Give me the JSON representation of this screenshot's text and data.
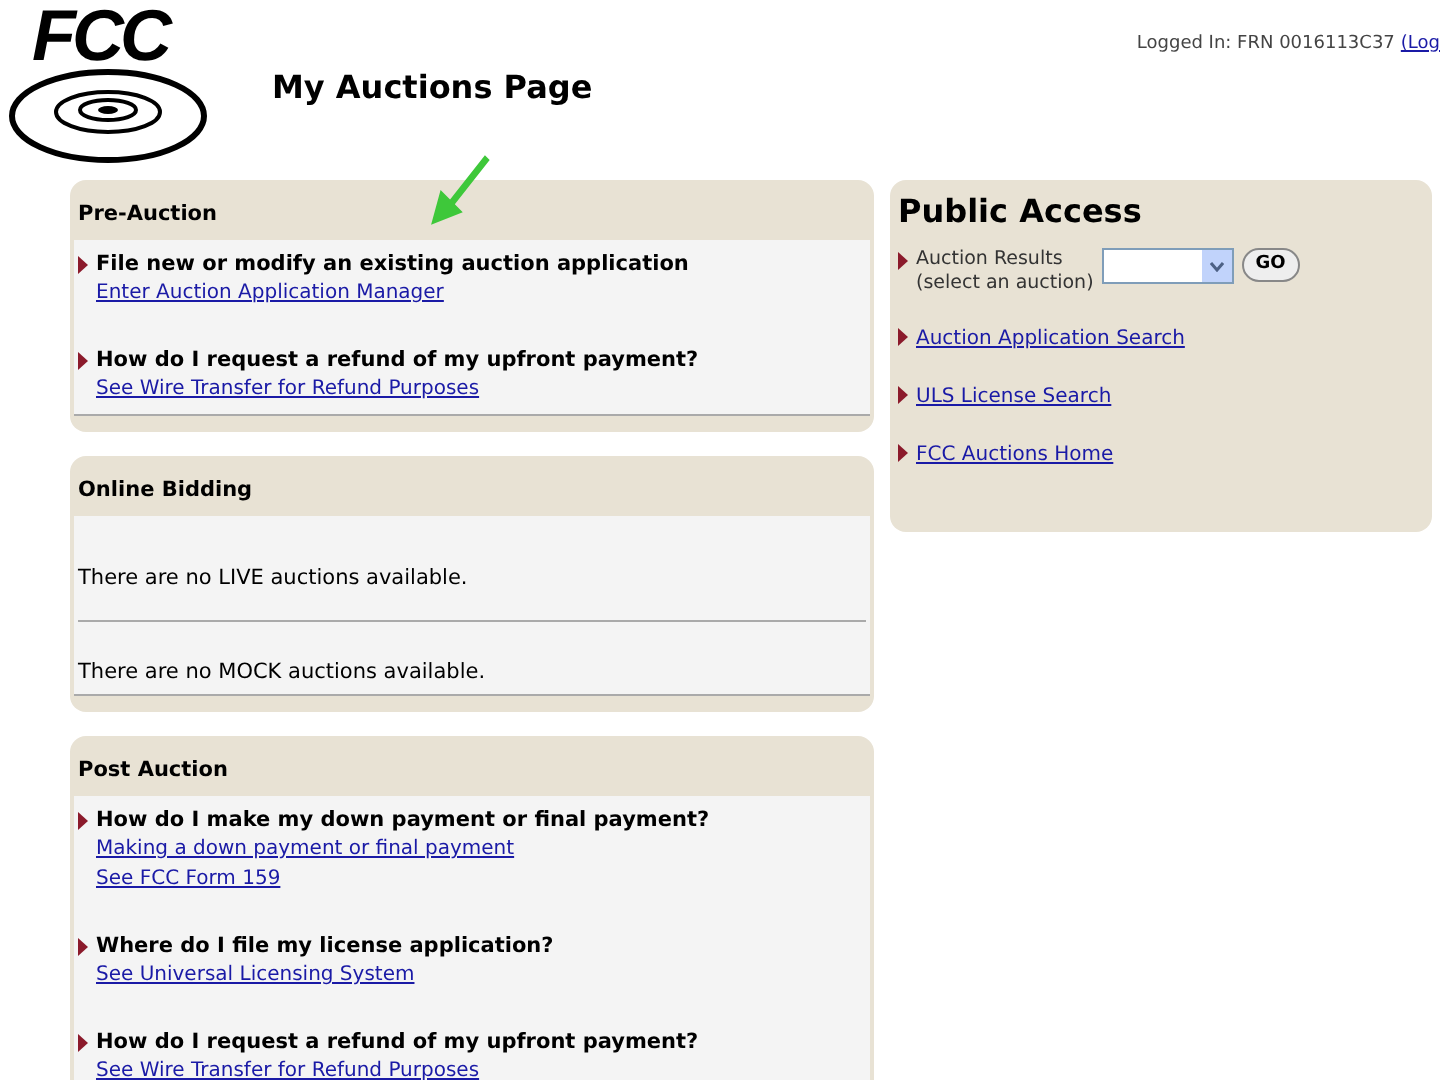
{
  "logo": {
    "text": "FCC"
  },
  "page_title": "My Auctions Page",
  "login_status": {
    "text": "Logged In: FRN 0016113C37",
    "link": "(Log"
  },
  "pre_auction": {
    "title": "Pre-Auction",
    "items": [
      {
        "question": "File new or modify an existing auction application",
        "links": [
          "Enter Auction Application Manager"
        ]
      },
      {
        "question": "How do I request a refund of my upfront payment?",
        "links": [
          "See Wire Transfer for Refund Purposes"
        ]
      }
    ]
  },
  "online_bidding": {
    "title": "Online Bidding",
    "messages": [
      "There are no LIVE auctions available.",
      "There are no MOCK auctions available."
    ]
  },
  "post_auction": {
    "title": "Post Auction",
    "items": [
      {
        "question": "How do I make my down payment or final payment?",
        "links": [
          "Making a down payment or final payment",
          "See FCC Form 159"
        ]
      },
      {
        "question": "Where do I file my license application?",
        "links": [
          "See Universal Licensing System"
        ]
      },
      {
        "question": "How do I request a refund of my upfront payment?",
        "links": [
          "See Wire Transfer for Refund Purposes"
        ]
      }
    ]
  },
  "public_access": {
    "title": "Public Access",
    "auction_results": {
      "label": "Auction Results",
      "hint": "(select an auction)",
      "go_button": "GO"
    },
    "links": [
      "Auction Application Search",
      "ULS License Search",
      "FCC Auctions Home"
    ]
  }
}
